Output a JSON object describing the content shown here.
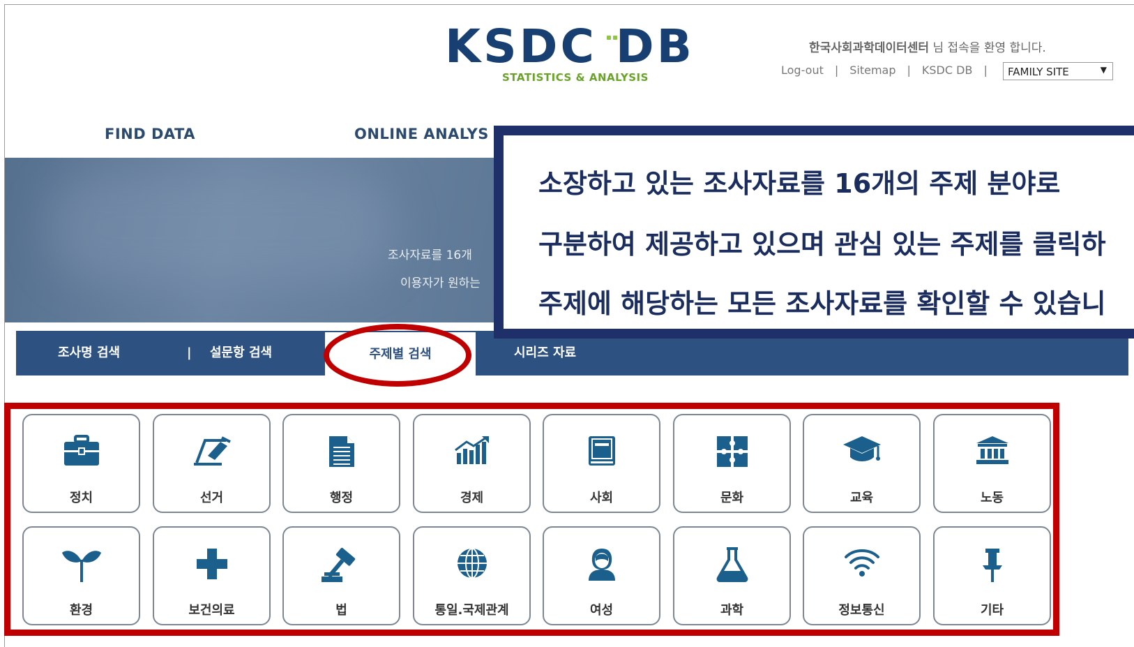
{
  "header": {
    "logo_main": "KSDC DB",
    "logo_sub": "STATISTICS & ANALYSIS",
    "welcome_org": "한국사회과학데이터센터",
    "welcome_suffix": " 님 접속을 환영 합니다.",
    "util_links": [
      "Log-out",
      "Sitemap",
      "KSDC DB"
    ],
    "family_site": "FAMILY SITE"
  },
  "nav": {
    "items": [
      "FIND DATA",
      "ONLINE ANALYS"
    ]
  },
  "hero": {
    "line1": "조사자료를 16개",
    "line2": "이용자가 원하는"
  },
  "tabs": {
    "items": [
      "조사명 검색",
      "설문항 검색",
      "주제별 검색",
      "시리즈 자료"
    ],
    "separator": "|",
    "active": "주제별 검색"
  },
  "callout": {
    "lines": [
      "소장하고 있는 조사자료를 16개의 주제 분야로",
      "구분하여 제공하고 있으며 관심 있는 주제를 클릭하",
      "주제에 해당하는 모든 조사자료를 확인할 수 있습니"
    ]
  },
  "topics": [
    {
      "label": "정치",
      "icon": "briefcase-icon"
    },
    {
      "label": "선거",
      "icon": "ballot-icon"
    },
    {
      "label": "행정",
      "icon": "document-icon"
    },
    {
      "label": "경제",
      "icon": "growth-chart-icon"
    },
    {
      "label": "사회",
      "icon": "book-icon"
    },
    {
      "label": "문화",
      "icon": "puzzle-icon"
    },
    {
      "label": "교육",
      "icon": "graduation-cap-icon"
    },
    {
      "label": "노동",
      "icon": "institution-icon"
    },
    {
      "label": "환경",
      "icon": "sprout-icon"
    },
    {
      "label": "보건의료",
      "icon": "medical-cross-icon"
    },
    {
      "label": "법",
      "icon": "gavel-icon"
    },
    {
      "label": "통일.국제관계",
      "icon": "globe-icon"
    },
    {
      "label": "여성",
      "icon": "woman-icon"
    },
    {
      "label": "과학",
      "icon": "flask-icon"
    },
    {
      "label": "정보통신",
      "icon": "wifi-icon"
    },
    {
      "label": "기타",
      "icon": "pushpin-icon"
    }
  ],
  "colors": {
    "brand_navy": "#173f71",
    "brand_green": "#6aa32a",
    "tab_bar": "#2d5180",
    "highlight_red": "#c00000",
    "icon_blue": "#1b5f8c"
  }
}
